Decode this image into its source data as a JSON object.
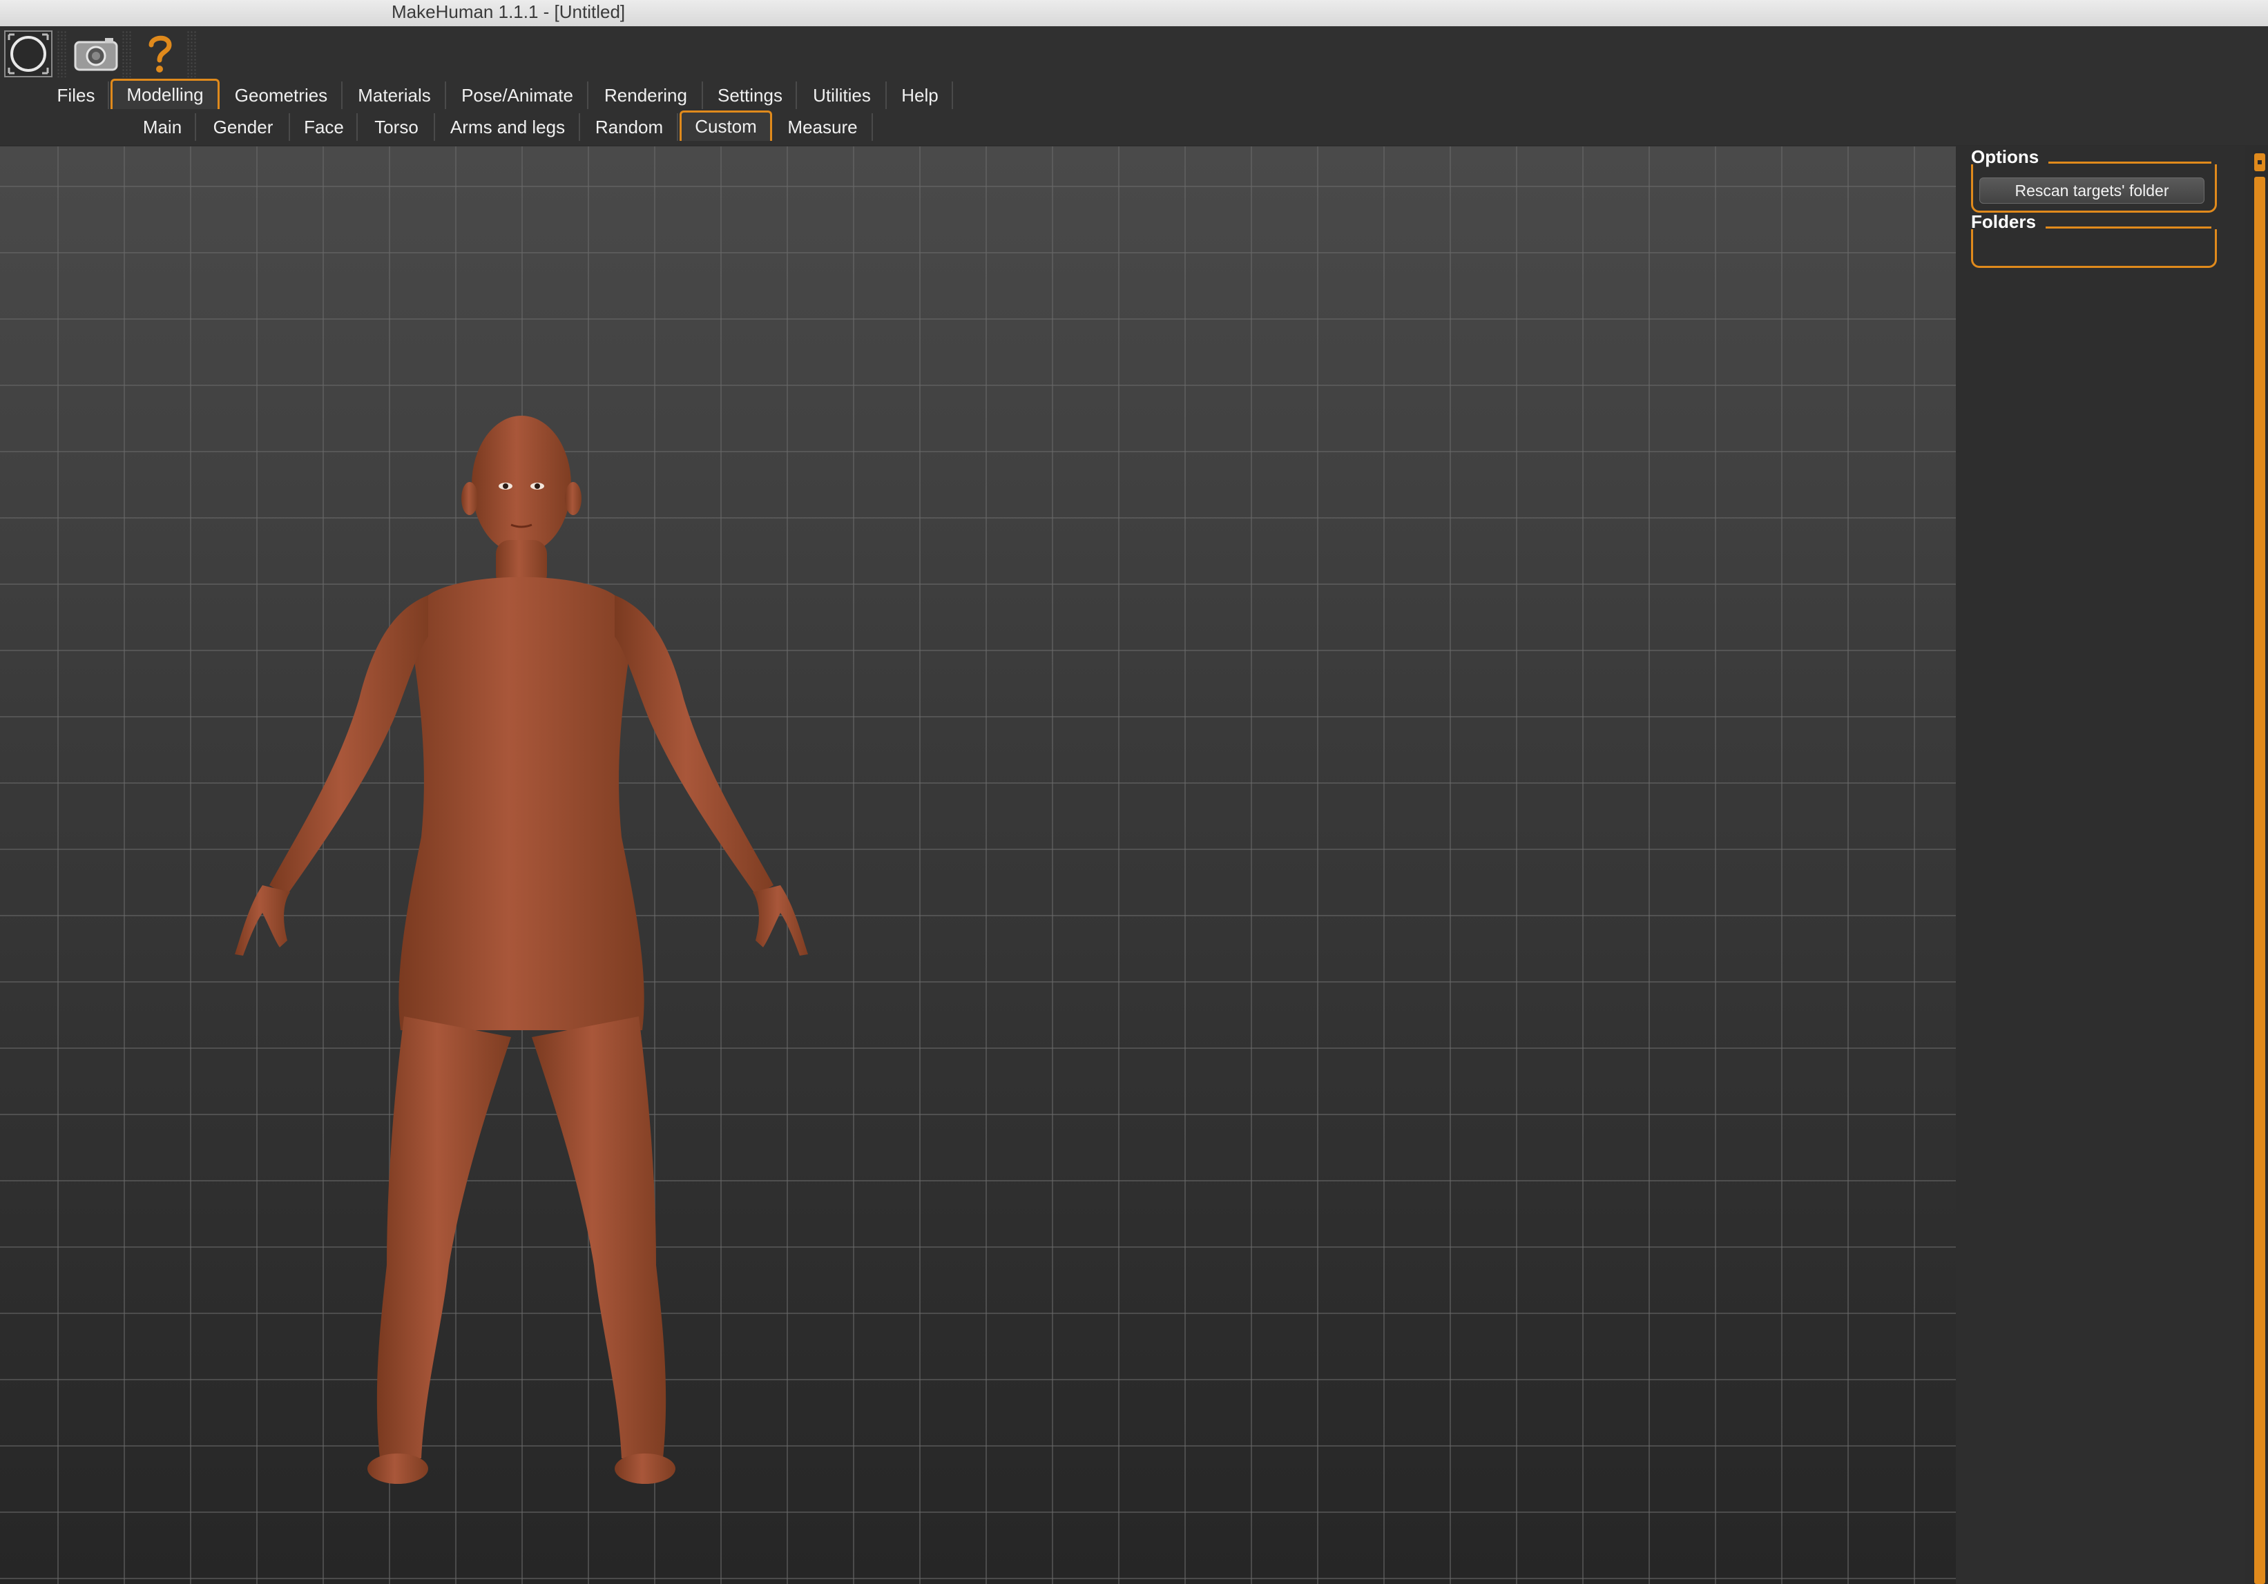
{
  "window": {
    "title": "MakeHuman 1.1.1 - [Untitled]"
  },
  "toolbar": {
    "icons": [
      "circle-icon",
      "camera-icon",
      "help-question-icon"
    ]
  },
  "main_tabs": [
    {
      "label": "Files",
      "active": false
    },
    {
      "label": "Modelling",
      "active": true
    },
    {
      "label": "Geometries",
      "active": false
    },
    {
      "label": "Materials",
      "active": false
    },
    {
      "label": "Pose/Animate",
      "active": false
    },
    {
      "label": "Rendering",
      "active": false
    },
    {
      "label": "Settings",
      "active": false
    },
    {
      "label": "Utilities",
      "active": false
    },
    {
      "label": "Help",
      "active": false
    }
  ],
  "sub_tabs": [
    {
      "label": "Main",
      "active": false
    },
    {
      "label": "Gender",
      "active": false
    },
    {
      "label": "Face",
      "active": false
    },
    {
      "label": "Torso",
      "active": false
    },
    {
      "label": "Arms and legs",
      "active": false
    },
    {
      "label": "Random",
      "active": false
    },
    {
      "label": "Custom",
      "active": true
    },
    {
      "label": "Measure",
      "active": false
    }
  ],
  "right_panel": {
    "options": {
      "label": "Options",
      "rescan_button": "Rescan targets' folder"
    },
    "folders": {
      "label": "Folders"
    }
  },
  "colors": {
    "accent": "#e08a1c",
    "background": "#2d2d2d",
    "skin": "#a0502e"
  }
}
